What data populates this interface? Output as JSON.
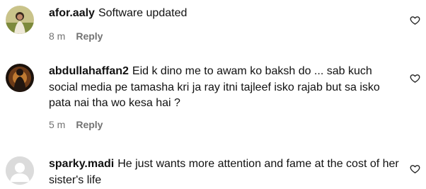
{
  "comments": [
    {
      "username": "afor.aaly",
      "text": "Software updated",
      "time": "8 m",
      "reply_label": "Reply",
      "avatar_icon": "profile-photo",
      "like_icon": "heart-outline-icon"
    },
    {
      "username": "abdullahaffan2",
      "text": "Eid k dino me to awam ko baksh do ... sab kuch social media pe tamasha kri ja ray itni tajleef isko rajab but sa isko pata nai tha wo kesa hai ?",
      "time": "5 m",
      "reply_label": "Reply",
      "avatar_icon": "profile-photo",
      "like_icon": "heart-outline-icon"
    },
    {
      "username": "sparky.madi",
      "text": "He just wants more attention and fame at the cost of her sister's life",
      "avatar_icon": "default-user-icon",
      "like_icon": "heart-outline-icon"
    }
  ],
  "colors": {
    "meta_text": "#737373",
    "body_text": "#111111",
    "default_avatar_bg": "#dbdbdb"
  }
}
